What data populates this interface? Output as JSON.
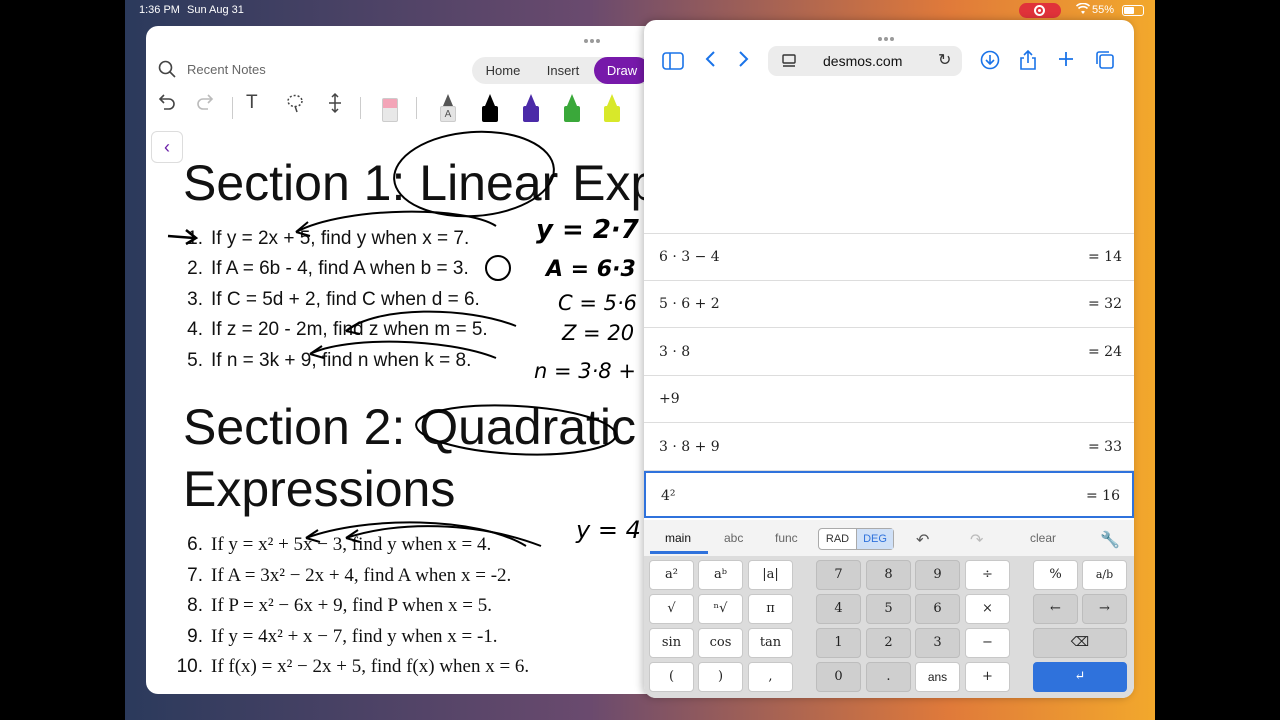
{
  "status": {
    "time": "1:36 PM",
    "date": "Sun Aug 31",
    "battery": "55%",
    "battery_level": 0.55
  },
  "notes": {
    "recent_label": "Recent Notes",
    "tabs": [
      "Home",
      "Insert",
      "Draw"
    ],
    "active_tab": "Draw",
    "section1_title": "Section 1: Linear Exp",
    "section2_title_line1": "Section 2: Quadratic",
    "section2_title_line2": "Expressions",
    "problems_linear": [
      {
        "num": "1.",
        "text": "If y = 2x + 5, find y when x = 7."
      },
      {
        "num": "2.",
        "text": "If A = 6b - 4, find A when b = 3."
      },
      {
        "num": "3.",
        "text": "If C = 5d + 2, find C when d = 6."
      },
      {
        "num": "4.",
        "text": "If z = 20 - 2m, find z when m = 5."
      },
      {
        "num": "5.",
        "text": "If n = 3k + 9, find n when k = 8."
      }
    ],
    "problems_quadratic": [
      {
        "num": "6.",
        "text": "If y = x² + 5x − 3, find y when x = 4."
      },
      {
        "num": "7.",
        "text": "If A = 3x² − 2x + 4, find A when x = -2."
      },
      {
        "num": "8.",
        "text": "If P = x² − 6x + 9, find P when x = 5."
      },
      {
        "num": "9.",
        "text": "If y = 4x² + x − 7, find y when x = -1."
      },
      {
        "num": "10.",
        "text": "If f(x) = x² − 2x + 5, find f(x) when x = 6."
      }
    ],
    "handwriting": [
      "y = 2·7",
      "A = 6·3 −",
      "C = 5·6",
      "Z = 20",
      "n = 3·8 +",
      "y = 4"
    ]
  },
  "safari": {
    "url": "desmos.com",
    "expressions": [
      {
        "expr": "6 · 3 − 4",
        "result": "= 14"
      },
      {
        "expr": "5 · 6 + 2",
        "result": "= 32"
      },
      {
        "expr": "3 · 8",
        "result": "= 24"
      },
      {
        "expr": "+9",
        "result": ""
      },
      {
        "expr": "3 · 8 + 9",
        "result": "= 33"
      },
      {
        "expr": "4²",
        "result": "= 16"
      }
    ],
    "keypad_tabs": [
      "main",
      "abc",
      "func"
    ],
    "angle_modes": [
      "RAD",
      "DEG"
    ],
    "active_angle_mode": "DEG",
    "clear_label": "clear",
    "keys_left": [
      "a²",
      "aᵇ",
      "|a|",
      "√",
      "ⁿ√",
      "π",
      "sin",
      "cos",
      "tan",
      "(",
      ")",
      ","
    ],
    "keys_mid": [
      "7",
      "8",
      "9",
      "÷",
      "4",
      "5",
      "6",
      "×",
      "1",
      "2",
      "3",
      "−",
      "0",
      ".",
      "ans",
      "+"
    ],
    "keys_right": [
      "%",
      "a/b",
      "←",
      "→",
      "⌫",
      "↵"
    ]
  }
}
